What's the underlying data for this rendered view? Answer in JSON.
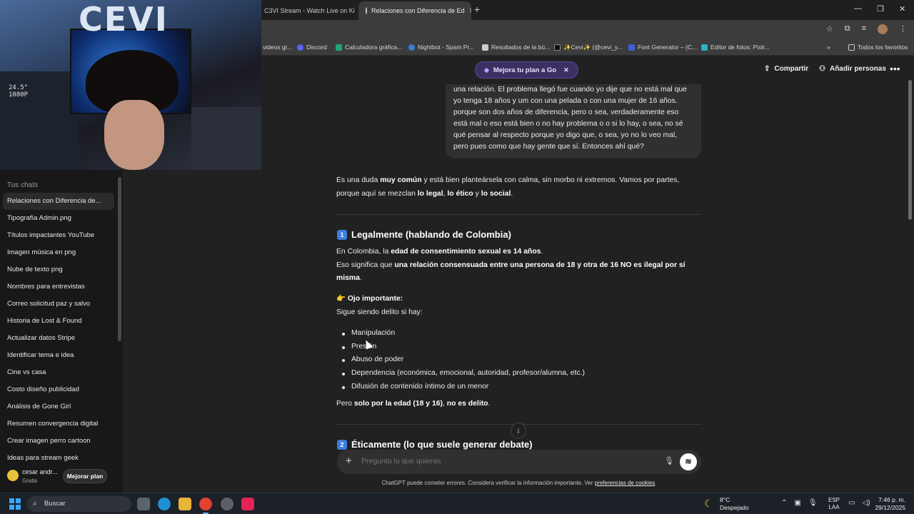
{
  "browser": {
    "tabs": [
      {
        "label": "C3VI Stream - Watch Live on Ki"
      },
      {
        "label": "Relaciones con Diferencia de Ed"
      }
    ],
    "new_tab": "+",
    "window": {
      "minimize": "—",
      "restore": "❐",
      "close": "✕"
    },
    "bookmarks": [
      {
        "label": "videos gr..."
      },
      {
        "label": "Discord",
        "color": "#5865f2"
      },
      {
        "label": "Calculadora gráfica...",
        "color": "#1fa57a"
      },
      {
        "label": "Nightbot - Spam Pr...",
        "color": "#3a7bd5"
      },
      {
        "label": "Resultados de la bú...",
        "color": "#cccccc"
      },
      {
        "label": "✨Cevi✨ (@cevi_y...",
        "color": "#111111"
      },
      {
        "label": "Font Generator – (C...",
        "color": "#3e5fd6"
      },
      {
        "label": "Editor de fotos: Pixlr...",
        "color": "#2bb3c0"
      },
      {
        "label": "»"
      },
      {
        "label": "Todos los favoritos"
      }
    ]
  },
  "webcam": {
    "logo": "CEVI",
    "shelf_text": "24.5\"\n1080P"
  },
  "sidebar": {
    "title": "Tus chats",
    "items": [
      {
        "label": "Relaciones con Diferencia de..."
      },
      {
        "label": "Tipografía Admin.png"
      },
      {
        "label": "Títulos impactantes YouTube"
      },
      {
        "label": "Imagen música en png"
      },
      {
        "label": "Nube de texto png"
      },
      {
        "label": "Nombres para entrevistas"
      },
      {
        "label": "Correo solicitud paz y salvo"
      },
      {
        "label": "Historia de Lost & Found"
      },
      {
        "label": "Actualizar datos Stripe"
      },
      {
        "label": "Identificar tema e idea"
      },
      {
        "label": "Cine vs casa"
      },
      {
        "label": "Costo diseño publicidad"
      },
      {
        "label": "Análisis de Gone Girl"
      },
      {
        "label": "Resumen convergencia digital"
      },
      {
        "label": "Crear imagen perro cartoon"
      },
      {
        "label": "Ideas para stream geek"
      }
    ],
    "user": {
      "name": "cesar andr...",
      "plan": "Gratis",
      "upgrade": "Mejorar plan"
    }
  },
  "topbar": {
    "promo": "Mejora tu plan a Go",
    "share": "Compartir",
    "add_people": "Añadir personas",
    "more": "•••"
  },
  "chat": {
    "user_message": "una relación. El problema llegó fue cuando yo dije que no está mal que yo tenga 18 años y um con una pelada o con una mujer de 16 años. porque son dos años de diferencia, pero o sea, verdaderamente eso está mal o eso está bien o no hay problema o o si lo hay, o sea, no sé qué pensar al respecto porque yo digo que, o sea, yo no lo veo mal, pero pues como que hay gente que sí. Entonces ahí qué?",
    "intro": {
      "p1_a": "Es una duda ",
      "p1_b": "muy común",
      "p1_c": " y está bien planteársela con calma, sin morbo ni extremos. Vamos por partes, porque aquí se mezclan ",
      "p1_d": "lo legal",
      "p1_e": ", ",
      "p1_f": "lo ético",
      "p1_g": " y ",
      "p1_h": "lo social",
      "p1_i": "."
    },
    "section1": {
      "num": "1",
      "title": "Legalmente (hablando de Colombia)",
      "l1_a": "En Colombia, la ",
      "l1_b": "edad de consentimiento sexual es 14 años",
      "l1_c": ".",
      "l2_a": "Eso significa que ",
      "l2_b": "una relación consensuada entre una persona de 18 y otra de 16 NO es ilegal por sí misma",
      "l2_c": ".",
      "note_icon": "👉",
      "note_title": "Ojo importante:",
      "note_text": "Sigue siendo delito si hay:",
      "bullets": [
        "Manipulación",
        "Presión",
        "Abuso de poder",
        "Dependencia (económica, emocional, autoridad, profesor/alumna, etc.)",
        "Difusión de contenido íntimo de un menor"
      ],
      "end_a": "Pero ",
      "end_b": "solo por la edad (18 y 16)",
      "end_c": ", ",
      "end_d": "no es delito",
      "end_e": "."
    },
    "section2": {
      "num": "2",
      "title": "Éticamente (lo que suele generar debate)"
    }
  },
  "composer": {
    "placeholder": "Pregunta lo que quieras",
    "disclaimer_a": "ChatGPT puede cometer errores. Considera verificar la información importante. Ver ",
    "disclaimer_link": "preferencias de cookies",
    "disclaimer_b": "."
  },
  "taskbar": {
    "search": "Buscar",
    "weather_temp": "8°C",
    "weather_desc": "Despejado",
    "lang_1": "ESP",
    "lang_2": "LAA",
    "time": "7:46 p. m.",
    "date": "29/12/2025"
  }
}
